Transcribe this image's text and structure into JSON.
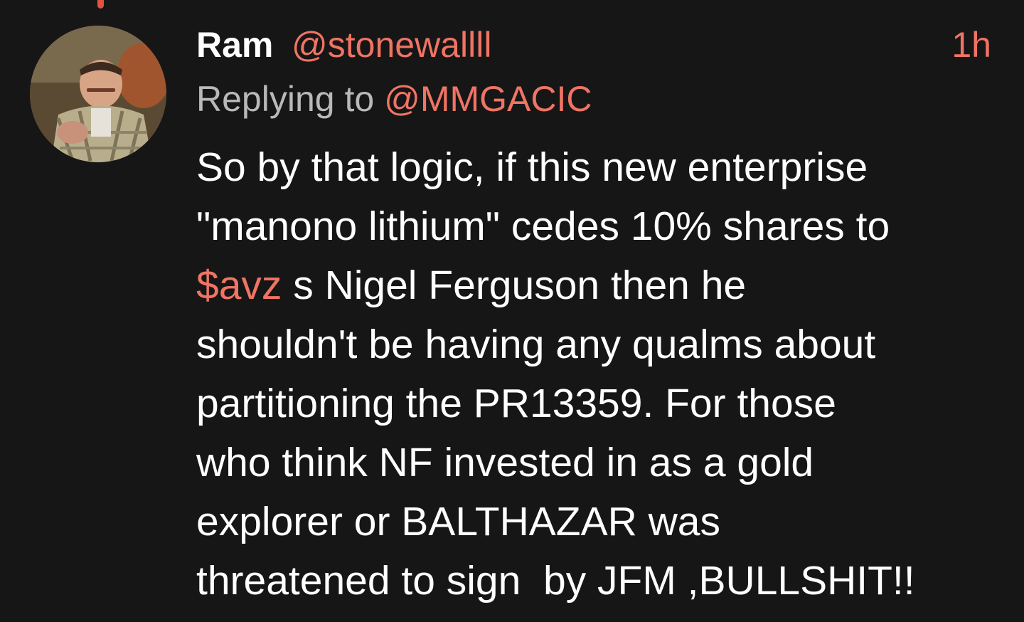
{
  "tweet": {
    "author": {
      "display_name": "Ram",
      "handle": "@stonewallll"
    },
    "timestamp": "1h",
    "reply": {
      "prefix": "Replying to",
      "target": "@MMGACIC"
    },
    "body": {
      "line1": "So by that logic, if this new enterprise",
      "line2": "\"manono lithium\" cedes 10% shares to",
      "line3_cashtag": "$avz",
      "line3_rest": " s Nigel Ferguson then he",
      "line4": "shouldn't be having any qualms about",
      "line5": "partitioning the PR13359. For those",
      "line6": "who think NF invested in as a gold",
      "line7": "explorer or BALTHAZAR was",
      "line8": "threatened to sign  by JFM ,BULLSHIT!!"
    }
  },
  "colors": {
    "background": "#161616",
    "accent": "#f07464",
    "muted_text": "#b9b9b9",
    "text": "#ffffff"
  }
}
